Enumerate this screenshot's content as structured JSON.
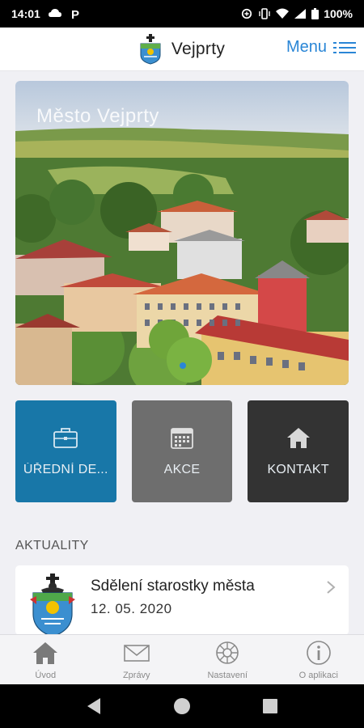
{
  "status_bar": {
    "time": "14:01",
    "battery": "100%"
  },
  "header": {
    "title": "Vejprty",
    "menu_label": "Menu"
  },
  "hero": {
    "title": "Město Vejprty"
  },
  "tiles": [
    {
      "label": "ÚŘEDNÍ DE...",
      "icon": "briefcase-icon",
      "color": "#1877a8"
    },
    {
      "label": "AKCE",
      "icon": "calendar-icon",
      "color": "#6e6e6e"
    },
    {
      "label": "KONTAKT",
      "icon": "home-icon",
      "color": "#333333"
    }
  ],
  "news": {
    "section_title": "AKTUALITY",
    "items": [
      {
        "title": "Sdělení starostky města",
        "date": "12. 05. 2020"
      }
    ]
  },
  "bottom_nav": [
    {
      "label": "Úvod",
      "icon": "home-icon"
    },
    {
      "label": "Zprávy",
      "icon": "envelope-icon"
    },
    {
      "label": "Nastavení",
      "icon": "gear-icon"
    },
    {
      "label": "O aplikaci",
      "icon": "info-icon"
    }
  ],
  "colors": {
    "accent": "#2a86d6",
    "tile_blue": "#1877a8",
    "tile_gray": "#6e6e6e",
    "tile_dark": "#333333"
  }
}
